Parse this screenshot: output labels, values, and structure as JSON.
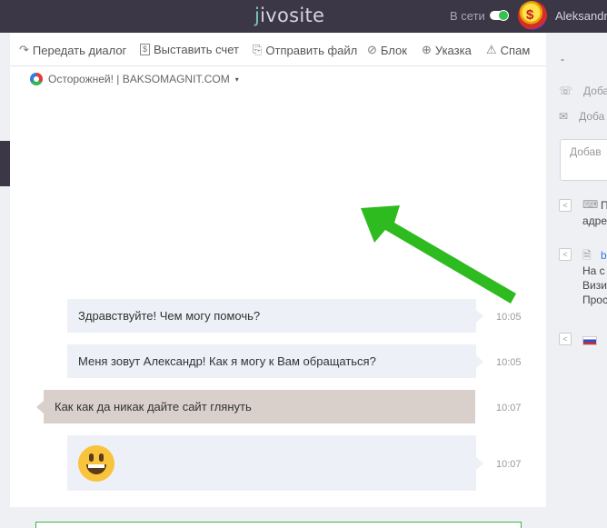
{
  "header": {
    "logo_prefix": "j",
    "logo_rest": "ivosite",
    "status_label": "В сети",
    "username": "Aleksandr",
    "avatar_icon": "dollar-coin-avatar-icon"
  },
  "toolbar": {
    "items": [
      {
        "icon": "↷",
        "label": "Передать диалог"
      },
      {
        "icon": "$",
        "label": "Выставить счет"
      },
      {
        "icon": "⎘",
        "label": "Отправить файл"
      },
      {
        "icon": "⊘",
        "label": "Блок"
      },
      {
        "icon": "⊕",
        "label": "Указка"
      },
      {
        "icon": "⚠",
        "label": "Спам"
      }
    ]
  },
  "site": {
    "label": "Осторожней! | BAKSOMAGNIT.COM",
    "caret": "▾"
  },
  "messages": [
    {
      "sender": "agent",
      "text": "Здравствуйте! Чем могу помочь?",
      "time": "10:05"
    },
    {
      "sender": "agent",
      "text": "Меня зовут Александр! Как я могу к Вам обращаться?",
      "time": "10:05"
    },
    {
      "sender": "client",
      "text": "Как как да никак дайте сайт глянуть",
      "time": "10:07"
    },
    {
      "sender": "agent",
      "text": "",
      "emoji": "grinning-face",
      "time": "10:07"
    }
  ],
  "sidebar": {
    "name": "-",
    "phone_icon": "☏",
    "phone_placeholder": "Доба",
    "email_icon": "✉",
    "email_placeholder": "Доба",
    "note_placeholder": "Добав",
    "collapse_icon": "<",
    "page_icon": "⌨",
    "page_line1": "П",
    "page_line2": "адре",
    "doc_icon": "🗎",
    "doc_link": "b",
    "doc_lines": [
      "На с",
      "Визи",
      "Прос"
    ],
    "country_flag": "russia-flag"
  },
  "colors": {
    "topbar": "#3b3747",
    "accent_green": "#36c24f",
    "arrow_green": "#2dbb1f",
    "agent_bubble": "#eef0f7",
    "client_bubble": "#d9d0cb"
  }
}
